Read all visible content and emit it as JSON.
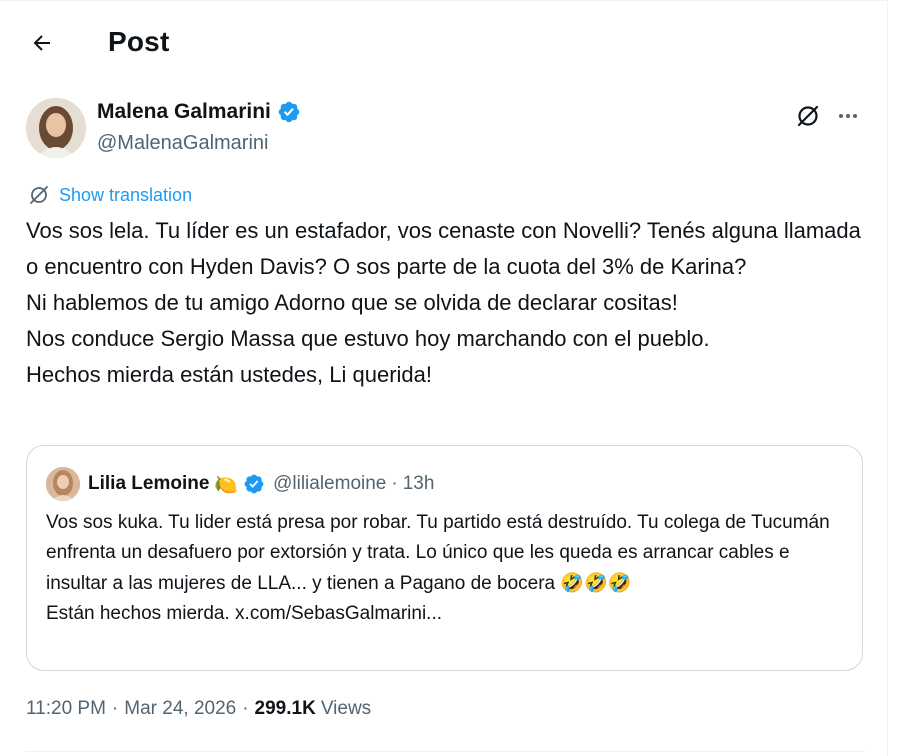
{
  "header": {
    "title": "Post"
  },
  "author": {
    "name": "Malena Galmarini",
    "handle": "@MalenaGalmarini"
  },
  "translation_link": "Show translation",
  "post": {
    "paragraphs": [
      "Vos sos lela. Tu líder es un estafador, vos cenaste con Novelli? Tenés alguna llamada o encuentro con Hyden Davis? O sos parte de la cuota del 3% de Karina?",
      "Ni hablemos de tu amigo Adorno que se olvida de declarar cositas!",
      "Nos conduce Sergio Massa que estuvo hoy marchando con el pueblo.",
      "Hechos mierda están ustedes, Li querida!"
    ]
  },
  "quote": {
    "name": "Lilia Lemoine",
    "name_emoji": "🍋",
    "handle": "@lilialemoine",
    "separator": "·",
    "time": "13h",
    "line1": "Vos sos kuka. Tu lider está presa por robar. Tu partido está destruído. Tu colega de Tucumán enfrenta un desafuero por extorsión y trata. Lo único que les queda es arrancar cables e insultar a las mujeres de LLA... y tienen a Pagano de bocera",
    "line1_emoji": "🤣🤣🤣",
    "line2": "Están hechos mierda. x.com/SebasGalmarini..."
  },
  "meta": {
    "time": "11:20 PM",
    "separator": "·",
    "date": "Mar 24, 2026",
    "separator2": "·",
    "views_count": "299.1K",
    "views_label": "Views"
  },
  "colors": {
    "accent": "#1d9bf0",
    "secondary_text": "#536471",
    "primary_text": "#0f1419",
    "border": "#cfd9de"
  },
  "icons": {
    "back": "arrow-left-icon",
    "verified": "verified-badge-icon",
    "grok": "grok-icon",
    "more": "more-dots-icon",
    "translate": "translate-icon"
  }
}
